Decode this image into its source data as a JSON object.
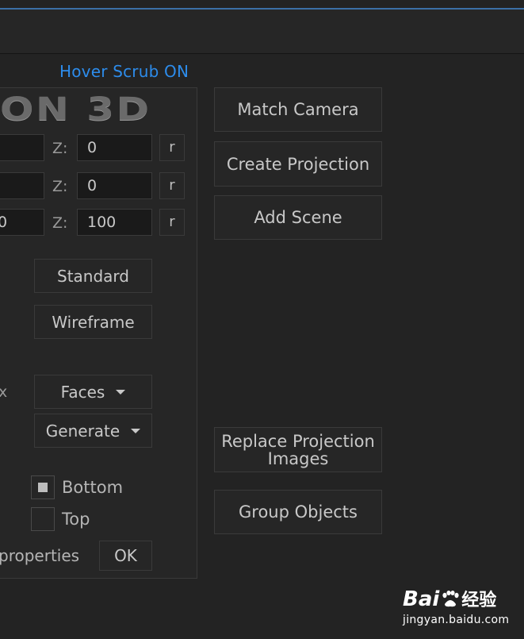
{
  "header": {
    "hover_scrub": "Hover Scrub ON",
    "logo_text": "ON 3D"
  },
  "coords": {
    "z_label": "Z:",
    "rows": [
      {
        "left_value": "",
        "z_value": "0",
        "reset": "r"
      },
      {
        "left_value": "",
        "z_value": "0",
        "reset": "r"
      },
      {
        "left_value": "0",
        "z_value": "100",
        "reset": "r"
      }
    ]
  },
  "render": {
    "standard": "Standard",
    "wireframe": "Wireframe"
  },
  "dropdowns": {
    "partial_label": "x",
    "faces": "Faces",
    "generate": "Generate"
  },
  "checkboxes": [
    {
      "label": "Bottom",
      "checked": true
    },
    {
      "label": "Top",
      "checked": false
    }
  ],
  "footer": {
    "properties": "properties",
    "ok": "OK"
  },
  "actions": {
    "match_camera": "Match Camera",
    "create_projection": "Create Projection",
    "add_scene": "Add Scene",
    "replace_line1": "Replace Projection",
    "replace_line2": "Images",
    "group_objects": "Group Objects"
  },
  "watermark": {
    "brand_left": "Bai",
    "brand_right": "经验",
    "url": "jingyan.baidu.com"
  },
  "colors": {
    "accent": "#2d8ceb",
    "background": "#232323",
    "border": "#3a3a3a"
  }
}
